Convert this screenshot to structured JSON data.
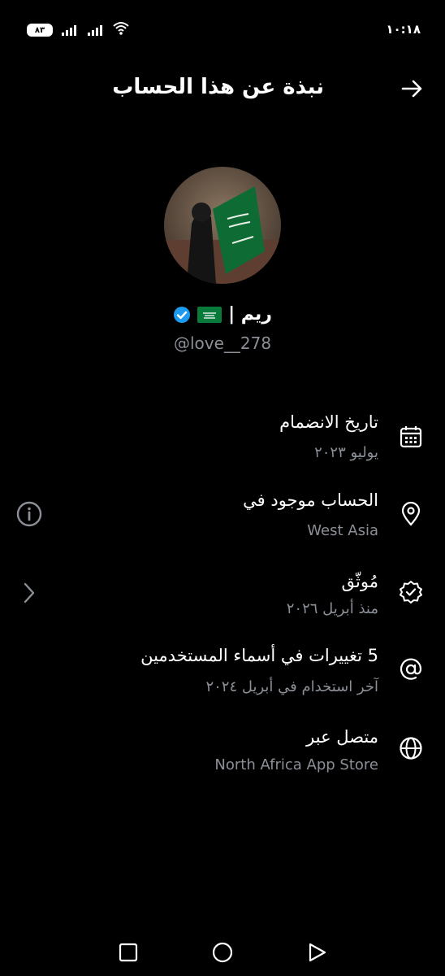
{
  "status_bar": {
    "time": "١٠:١٨",
    "battery": "٨٣"
  },
  "header": {
    "title": "نبذة عن هذا الحساب"
  },
  "profile": {
    "display_name": "ريم |",
    "handle": "@love__278"
  },
  "rows": [
    {
      "icon": "calendar-icon",
      "title": "تاريخ الانضمام",
      "subtitle": "يوليو ٢٠٢٣"
    },
    {
      "icon": "location-pin-icon",
      "title": "الحساب موجود في",
      "subtitle": "West Asia"
    },
    {
      "icon": "verified-check-icon",
      "title": "مُوثّق",
      "subtitle": "منذ أبريل ٢٠٢٦"
    },
    {
      "icon": "at-sign-icon",
      "title": "5 تغييرات في أسماء المستخدمين",
      "subtitle": "آخر استخدام في أبريل ٢٠٢٤"
    },
    {
      "icon": "globe-icon",
      "title": "متصل عبر",
      "subtitle": "North Africa App Store"
    }
  ],
  "colors": {
    "background": "#000000",
    "secondary_text": "#8b8f96",
    "verified_blue": "#1d9bf0"
  }
}
